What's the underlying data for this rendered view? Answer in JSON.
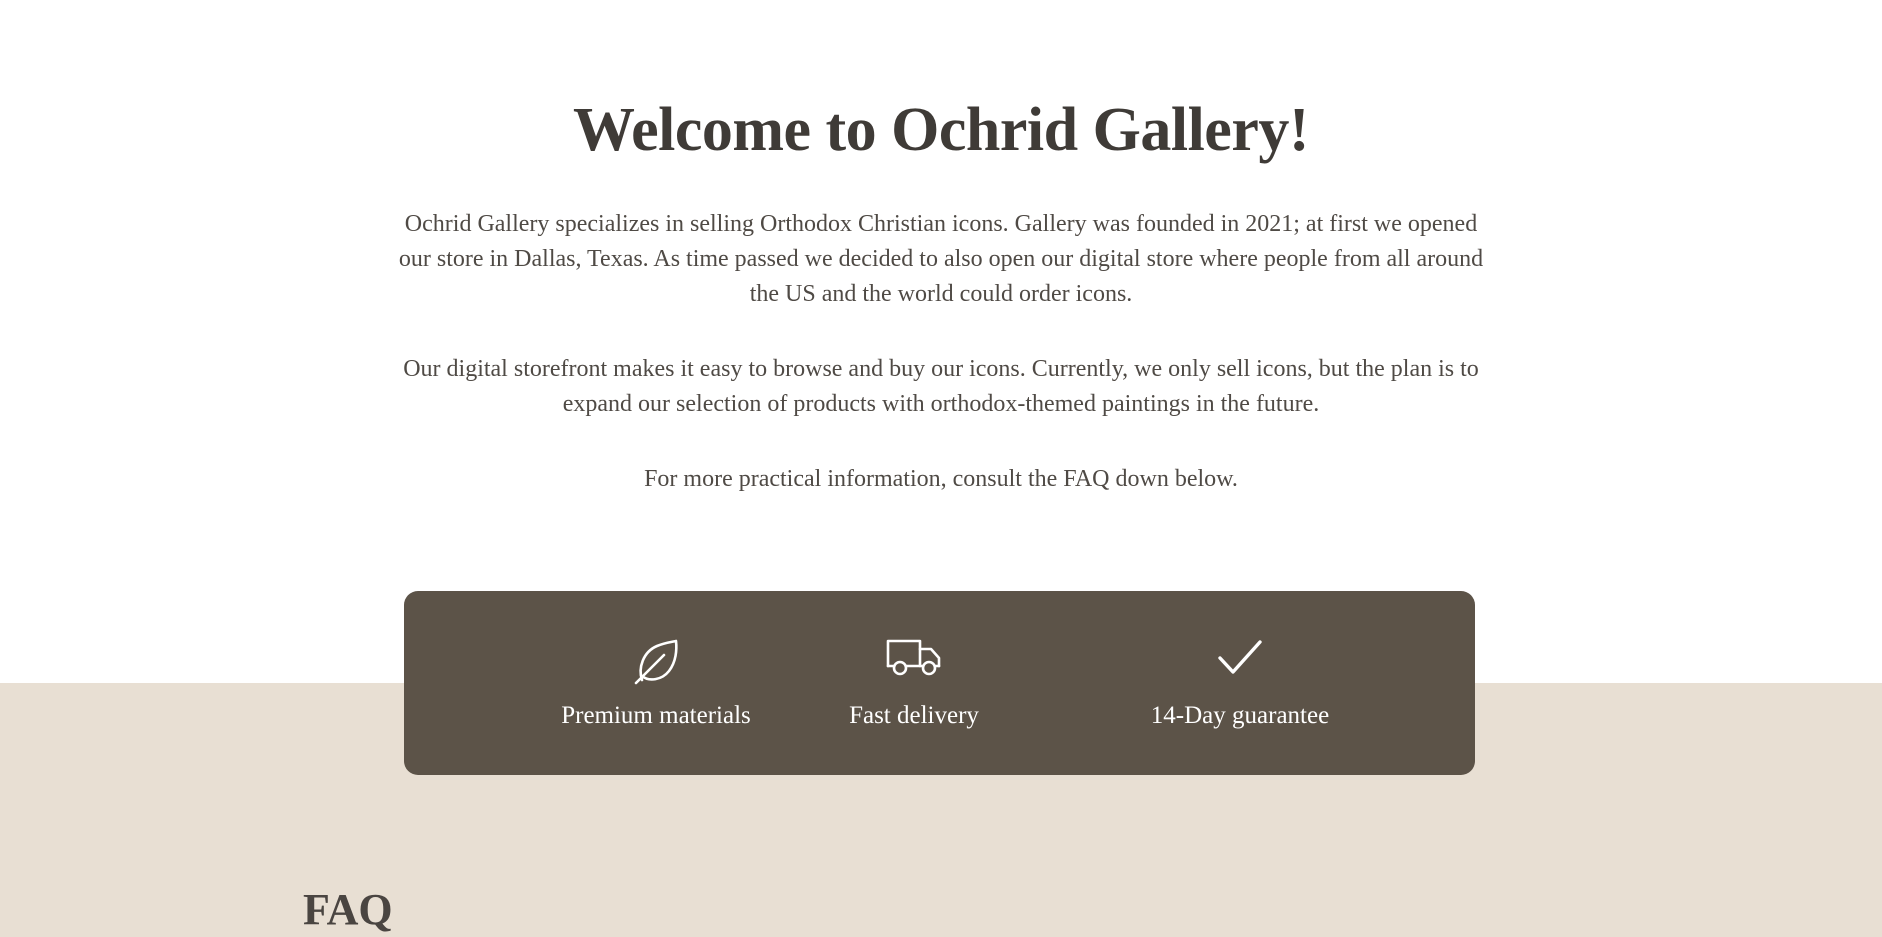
{
  "intro": {
    "title": "Welcome to Ochrid Gallery!",
    "paragraph1": "Ochrid Gallery specializes in selling Orthodox Christian icons. Gallery was founded in 2021; at first we opened our store in Dallas, Texas. As time passed we decided to also open our digital store where people from all around the US and the world could order icons.",
    "paragraph2": "Our digital storefront makes it easy to browse and buy our icons. Currently, we only sell icons, but the plan is to expand our selection of products with orthodox-themed paintings in the future.",
    "paragraph3": "For more practical information, consult the FAQ down below."
  },
  "features": [
    {
      "icon": "leaf-icon",
      "label": "Premium materials"
    },
    {
      "icon": "truck-icon",
      "label": "Fast delivery"
    },
    {
      "icon": "checkmark-icon",
      "label": "14-Day guarantee"
    }
  ],
  "faq": {
    "title": "FAQ"
  },
  "colors": {
    "background": "#ffffff",
    "band": "#e8dfd3",
    "features_bg": "#5c5348",
    "text": "#4a4541"
  }
}
